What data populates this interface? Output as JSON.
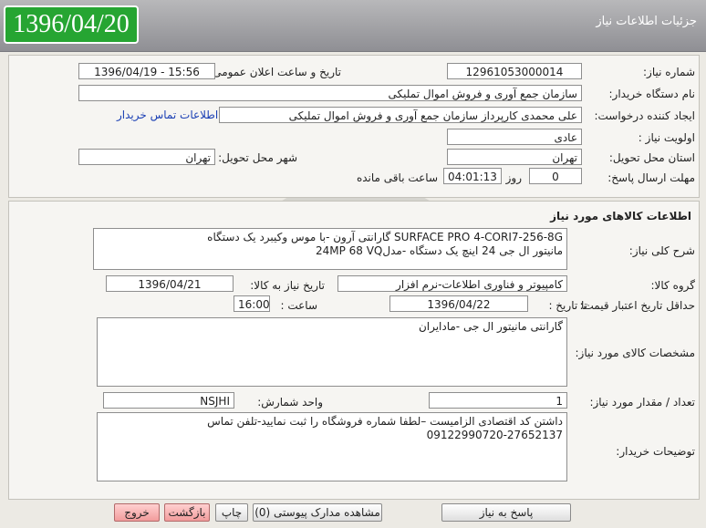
{
  "header": {
    "date": "1396/04/20",
    "title": "جزئیات اطلاعات نیاز"
  },
  "top": {
    "need_number_label": "شماره نیاز:",
    "need_number": "12961053000014",
    "announce_label": "تاریخ و ساعت اعلان عمومی:",
    "announce_value": "1396/04/19 - 15:56",
    "buyer_org_label": "نام دستگاه خریدار:",
    "buyer_org": "سازمان جمع آوری و فروش اموال تملیکی",
    "creator_label": "ایجاد کننده درخواست:",
    "creator": "علی محمدی کارپرداز سازمان جمع آوری و فروش اموال تملیکی",
    "contact_link": "اطلاعات تماس خریدار",
    "priority_label": "اولویت نیاز :",
    "priority": "عادی",
    "province_label": "استان محل تحویل:",
    "province": "تهران",
    "city_label": "شهر محل تحویل:",
    "city": "تهران",
    "deadline_label": "مهلت ارسال پاسخ:",
    "days": "0",
    "days_label": "روز و",
    "time": "04:01:13",
    "remaining_label": "ساعت باقی مانده"
  },
  "goods": {
    "section_title": "اطلاعات کالاهای مورد نیاز",
    "desc_label": "شرح کلی نیاز:",
    "desc_line1": "SURFACE PRO 4-CORI7-256-8G گارانتی آرون  -با موس وکیبرد یک دستگاه",
    "desc_line2": "مانیتور ال جی 24 اینچ یک دستگاه -مدل24MP 68 VQ",
    "group_label": "گروه کالا:",
    "group": "کامپیوتر و فناوری اطلاعات-نرم افزار",
    "need_date_label": "تاریخ نیاز به کالا:",
    "need_date": "1396/04/21",
    "price_validity_label": "حداقل تاریخ اعتبار قیمت:",
    "until_date_label": "تا تاریخ :",
    "until_date": "1396/04/22",
    "hour_label": "ساعت :",
    "hour": "16:00",
    "specs_label": "مشخصات کالای مورد نیاز:",
    "specs": "گارانتی مانیتور ال جی -مادایران",
    "qty_label": "تعداد / مقدار مورد نیاز:",
    "qty": "1",
    "unit_label": "واحد شمارش:",
    "unit": "NSJHI",
    "buyer_notes_label": "توضیحات خریدار:",
    "buyer_notes_line1": "داشتن کد اقتصادی الزامیست –لطفا شماره فروشگاه را ثبت نمایید-تلفن تماس",
    "buyer_notes_line2": "09122990720-27652137"
  },
  "buttons": {
    "reply": "پاسخ به نیاز",
    "attachments": "مشاهده مدارک پیوستی (0)",
    "print": "چاپ",
    "back": "بازگشت",
    "exit": "خروج"
  }
}
